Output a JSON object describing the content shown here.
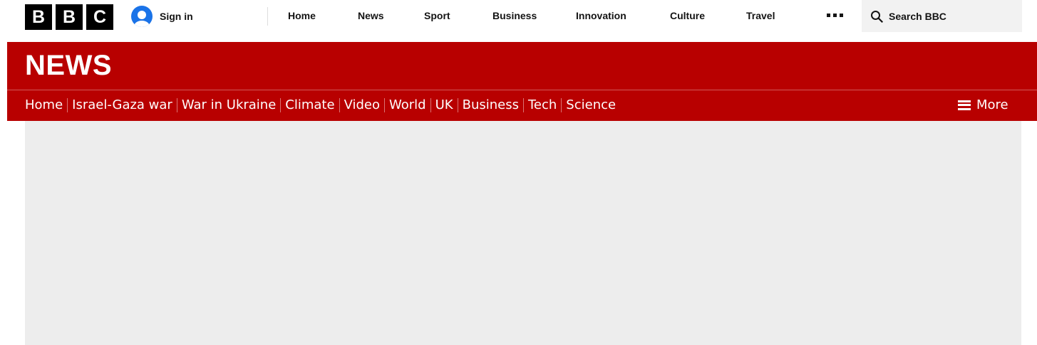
{
  "brand": {
    "letters": [
      "B",
      "B",
      "C"
    ]
  },
  "account": {
    "signin_label": "Sign in",
    "avatar_color": "#1a73e8"
  },
  "global_nav": {
    "items": [
      "Home",
      "News",
      "Sport",
      "Business",
      "Innovation",
      "Culture",
      "Travel"
    ],
    "more_icon": "more-dots-icon"
  },
  "search": {
    "label": "Search BBC",
    "icon": "search-icon"
  },
  "news": {
    "title": "NEWS",
    "accent_color": "#b80000",
    "subnav": [
      "Home",
      "Israel-Gaza war",
      "War in Ukraine",
      "Climate",
      "Video",
      "World",
      "UK",
      "Business",
      "Tech",
      "Science"
    ],
    "more_label": "More",
    "more_icon": "hamburger-icon"
  }
}
